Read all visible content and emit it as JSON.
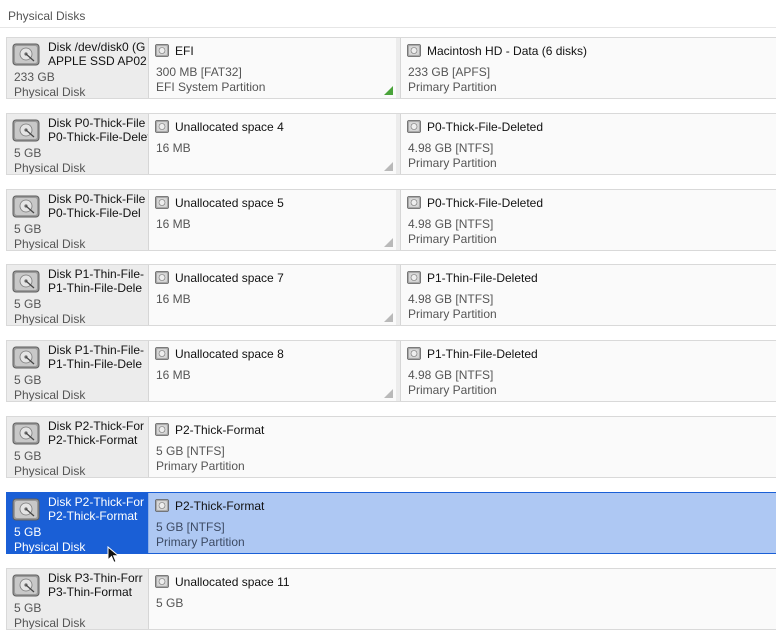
{
  "section_title": "Physical Disks",
  "rows": [
    {
      "disk_name_line1": "Disk /dev/disk0 (G",
      "disk_name_line2": "APPLE SSD AP02",
      "size": "233 GB",
      "kind": "Physical Disk",
      "selected": false,
      "partitions": [
        {
          "name": "EFI",
          "line1": "300 MB [FAT32]",
          "line2": "EFI System Partition",
          "grip": "green"
        },
        {
          "name": "Macintosh HD - Data (6 disks)",
          "line1": "233 GB [APFS]",
          "line2": "Primary Partition",
          "grip": ""
        }
      ]
    },
    {
      "disk_name_line1": "Disk P0-Thick-File",
      "disk_name_line2": "P0-Thick-File-Delet",
      "size": "5 GB",
      "kind": "Physical Disk",
      "selected": false,
      "partitions": [
        {
          "name": "Unallocated space 4",
          "line1": "16 MB",
          "line2": "",
          "grip": "gray"
        },
        {
          "name": "P0-Thick-File-Deleted",
          "line1": "4.98 GB [NTFS]",
          "line2": "Primary Partition",
          "grip": ""
        }
      ]
    },
    {
      "disk_name_line1": "Disk P0-Thick-File",
      "disk_name_line2": "P0-Thick-File-Del",
      "size": "5 GB",
      "kind": "Physical Disk",
      "selected": false,
      "partitions": [
        {
          "name": "Unallocated space 5",
          "line1": "16 MB",
          "line2": "",
          "grip": "gray"
        },
        {
          "name": "P0-Thick-File-Deleted",
          "line1": "4.98 GB [NTFS]",
          "line2": "Primary Partition",
          "grip": ""
        }
      ]
    },
    {
      "disk_name_line1": "Disk P1-Thin-File-",
      "disk_name_line2": "P1-Thin-File-Dele",
      "size": "5 GB",
      "kind": "Physical Disk",
      "selected": false,
      "partitions": [
        {
          "name": "Unallocated space 7",
          "line1": "16 MB",
          "line2": "",
          "grip": "gray"
        },
        {
          "name": "P1-Thin-File-Deleted",
          "line1": "4.98 GB [NTFS]",
          "line2": "Primary Partition",
          "grip": ""
        }
      ]
    },
    {
      "disk_name_line1": "Disk P1-Thin-File-",
      "disk_name_line2": "P1-Thin-File-Dele",
      "size": "5 GB",
      "kind": "Physical Disk",
      "selected": false,
      "partitions": [
        {
          "name": "Unallocated space 8",
          "line1": "16 MB",
          "line2": "",
          "grip": "gray"
        },
        {
          "name": "P1-Thin-File-Deleted",
          "line1": "4.98 GB [NTFS]",
          "line2": "Primary Partition",
          "grip": ""
        }
      ]
    },
    {
      "disk_name_line1": "Disk P2-Thick-For",
      "disk_name_line2": "P2-Thick-Format",
      "size": "5 GB",
      "kind": "Physical Disk",
      "selected": false,
      "partitions": [
        {
          "name": "P2-Thick-Format",
          "line1": "5 GB [NTFS]",
          "line2": "Primary Partition",
          "grip": ""
        }
      ]
    },
    {
      "disk_name_line1": "Disk P2-Thick-For",
      "disk_name_line2": "P2-Thick-Format",
      "size": "5 GB",
      "kind": "Physical Disk",
      "selected": true,
      "partitions": [
        {
          "name": "P2-Thick-Format",
          "line1": "5 GB [NTFS]",
          "line2": "Primary Partition",
          "grip": ""
        }
      ]
    },
    {
      "disk_name_line1": "Disk P3-Thin-Forr",
      "disk_name_line2": "P3-Thin-Format",
      "size": "5 GB",
      "kind": "Physical Disk",
      "selected": false,
      "partitions": [
        {
          "name": "Unallocated space 11",
          "line1": "5 GB",
          "line2": "",
          "grip": ""
        }
      ]
    }
  ],
  "icons": {
    "disk": "hard-disk-icon",
    "partition": "partition-icon",
    "cursor": "mouse-pointer-icon"
  },
  "colors": {
    "selection": "#1a5fd6",
    "selected_partition": "#aec8f3",
    "grip_green": "#4aa33a"
  }
}
